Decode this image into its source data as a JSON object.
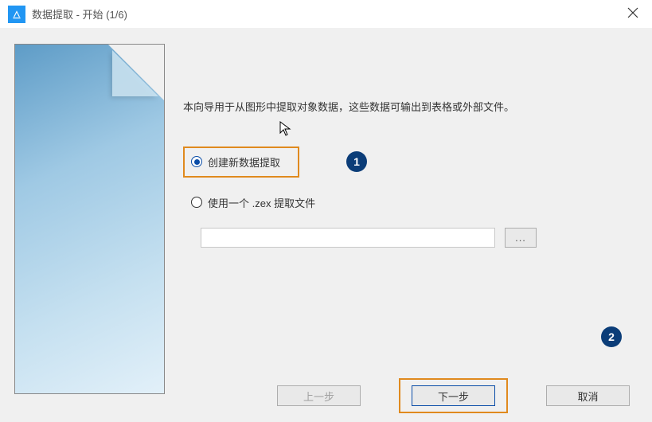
{
  "titlebar": {
    "title": "数据提取 - 开始 (1/6)"
  },
  "main": {
    "intro": "本向导用于从图形中提取对象数据，这些数据可输出到表格或外部文件。",
    "option_create": "创建新数据提取",
    "option_use_file": "使用一个 .zex 提取文件",
    "file_value": "",
    "browse_label": "..."
  },
  "callouts": {
    "one": "1",
    "two": "2"
  },
  "buttons": {
    "prev": "上一步",
    "next": "下一步",
    "cancel": "取消"
  }
}
